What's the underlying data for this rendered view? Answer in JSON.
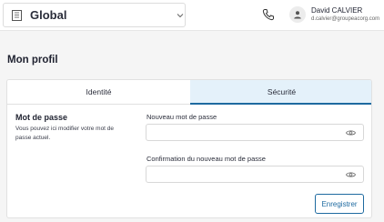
{
  "header": {
    "org_select": {
      "value": "Global"
    },
    "user": {
      "name": "David CALVIER",
      "email": "d.calvier@groupeacorg.com"
    }
  },
  "page": {
    "title": "Mon profil",
    "tabs": [
      {
        "label": "Identité",
        "active": false
      },
      {
        "label": "Sécurité",
        "active": true
      }
    ],
    "password_section": {
      "title": "Mot de passe",
      "description": "Vous pouvez ici modifier votre mot de passe actuel.",
      "new_password": {
        "label": "Nouveau mot de passe",
        "value": ""
      },
      "confirm_password": {
        "label": "Confirmation du nouveau mot de passe",
        "value": ""
      },
      "save_label": "Enregistrer"
    }
  },
  "colors": {
    "accent": "#1e6aa0",
    "active_tab_bg": "#e4f1fa"
  }
}
